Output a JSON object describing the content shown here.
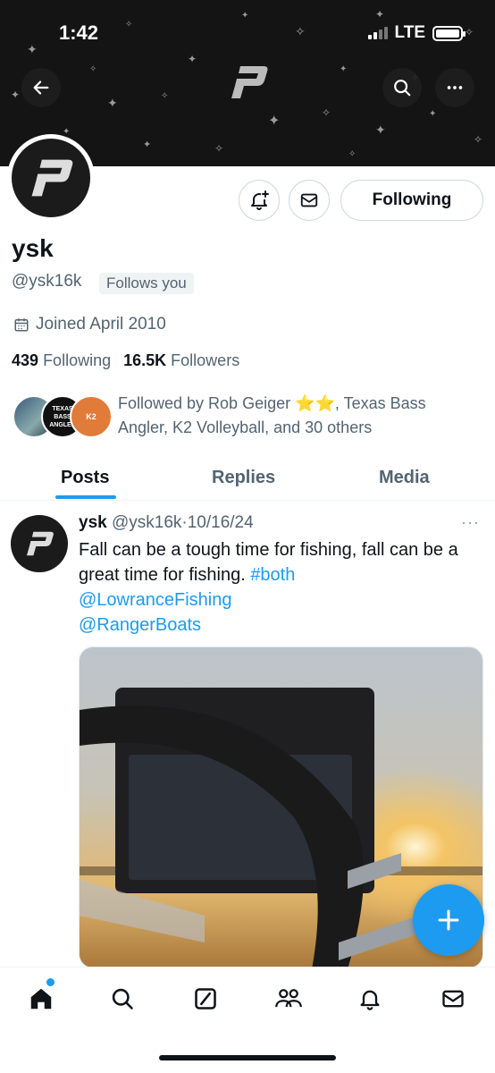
{
  "status": {
    "time": "1:42",
    "network": "LTE"
  },
  "profile": {
    "name": "ysk",
    "handle": "@ysk16k",
    "follows_you": "Follows you",
    "joined": "Joined April 2010",
    "following_count": "439",
    "following_label": "Following",
    "followers_count": "16.5K",
    "followers_label": "Followers",
    "followed_by": "Followed by Rob Geiger ⭐⭐, Texas Bass Angler, K2 Volleyball, and 30 others",
    "mini_avatars": [
      "",
      "TEXAS BASS ANGLER",
      "K2"
    ]
  },
  "actions": {
    "following_button": "Following"
  },
  "tabs": [
    {
      "label": "Posts"
    },
    {
      "label": "Replies"
    },
    {
      "label": "Media"
    }
  ],
  "post": {
    "name": "ysk",
    "handle": "@ysk16k",
    "separator": "·",
    "date": "10/16/24",
    "more": "···",
    "text": "Fall can be a tough time for fishing, fall can be a great time for fishing. ",
    "hashtag": "#both",
    "mention1": "@LowranceFishing",
    "mention2": "@RangerBoats"
  },
  "icons": {
    "back": "arrow-left-icon",
    "search": "search-icon",
    "more": "more-icon",
    "notify": "bell-plus-icon",
    "message": "envelope-icon",
    "calendar": "calendar-icon",
    "compose": "plus-icon",
    "nav": [
      "home-icon",
      "search-icon",
      "grok-icon",
      "communities-icon",
      "bell-icon",
      "mail-icon"
    ]
  },
  "colors": {
    "accent": "#1d9bf0",
    "text": "#0f1419",
    "muted": "#536471"
  }
}
